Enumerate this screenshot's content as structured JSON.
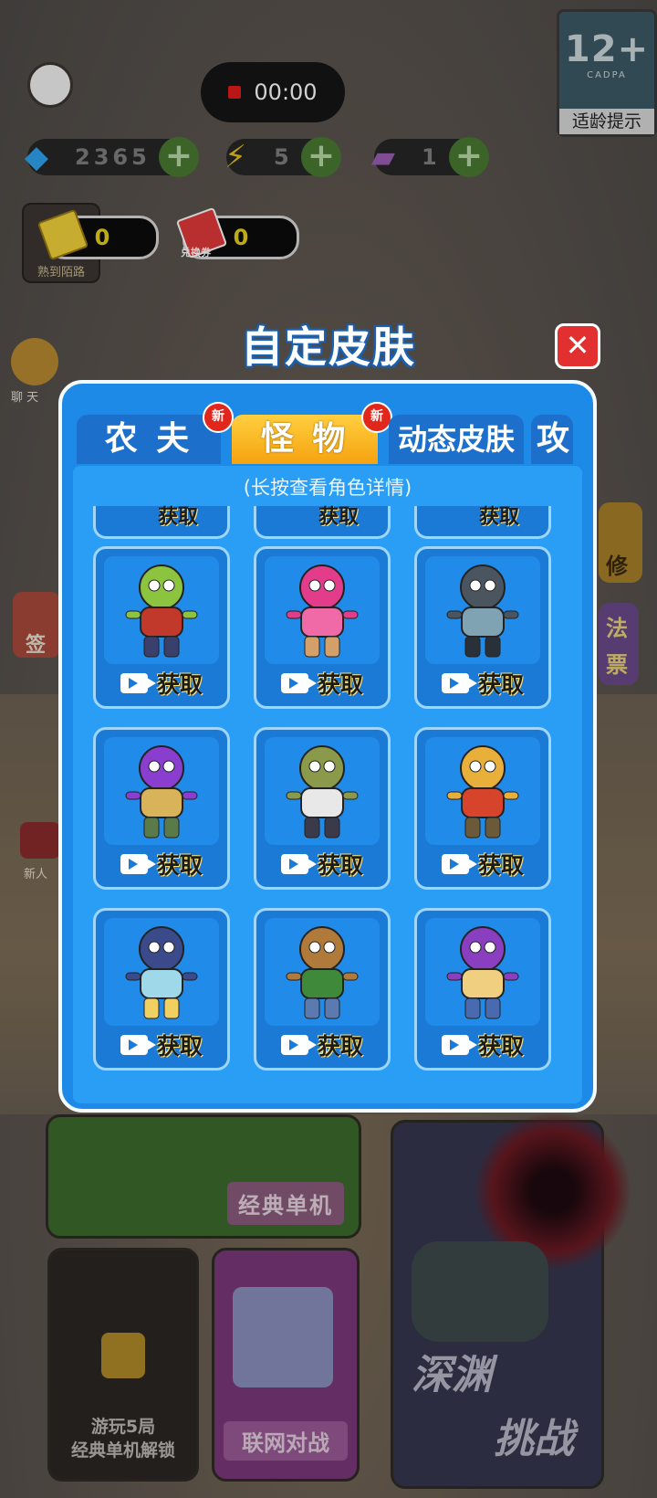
{
  "hud": {
    "timer": "00:00",
    "age_rating": {
      "number": "12+",
      "org": "CADPA",
      "tip": "适龄提示"
    },
    "resources": [
      {
        "name": "diamond",
        "icon": "diamond-icon",
        "value": "2365",
        "color": "#2fa3ee"
      },
      {
        "name": "energy",
        "icon": "lightning-icon",
        "value": "5",
        "color": "#e7c21a"
      },
      {
        "name": "ticket",
        "icon": "ticket-icon",
        "value": "1",
        "color": "#9b5fb4"
      }
    ],
    "tickets": [
      {
        "icon": "gold-ticket-icon",
        "value": "0"
      },
      {
        "icon": "red-redeem-ticket-icon",
        "value": "0",
        "label": "兑换券"
      }
    ],
    "sign_label": "熟到陌路"
  },
  "side_labels": {
    "chat": "聊 天",
    "sign": "签",
    "newbie": "新人",
    "repair": "修",
    "fa": "法",
    "piao": "票"
  },
  "dialog": {
    "title": "自定皮肤",
    "close_symbol": "✕",
    "tabs": [
      {
        "label": "农 夫",
        "badge": "新",
        "active": false
      },
      {
        "label": "怪 物",
        "badge": "新",
        "active": true
      },
      {
        "label": "动态皮肤",
        "badge": "",
        "active": false
      },
      {
        "label": "攻",
        "badge": "",
        "active": false
      }
    ],
    "hint": "(长按查看角色详情)",
    "get_label": "获取",
    "cards": [
      {
        "name": "green-zombie",
        "colors": [
          "#8cc43f",
          "#c0392b",
          "#3a3f6b"
        ]
      },
      {
        "name": "pink-swamp-monster",
        "colors": [
          "#e23c8a",
          "#f06aa8",
          "#d4a06a"
        ]
      },
      {
        "name": "armored-knight-monster",
        "colors": [
          "#4a5560",
          "#7fa3b3",
          "#2a3038"
        ]
      },
      {
        "name": "wizard-zombie",
        "colors": [
          "#8a3ed0",
          "#d8b35a",
          "#5a7a4a"
        ]
      },
      {
        "name": "muscle-zombie",
        "colors": [
          "#8a9a4a",
          "#e8e8e8",
          "#3a3a4a"
        ]
      },
      {
        "name": "cheetah-zombie",
        "colors": [
          "#e8b03a",
          "#d6452b",
          "#6a5a3a"
        ]
      },
      {
        "name": "qing-jiangshi",
        "colors": [
          "#3a4a8a",
          "#9fd8e8",
          "#f0d060"
        ]
      },
      {
        "name": "sack-head-zombie",
        "colors": [
          "#b07a3a",
          "#3f8a3a",
          "#5a7ab0"
        ]
      },
      {
        "name": "purple-crocodile",
        "colors": [
          "#8a3ec0",
          "#f0d080",
          "#4a6ab0"
        ]
      }
    ]
  },
  "modes": {
    "classic": "经典单机",
    "locked": [
      "游玩5局",
      "经典单机解锁"
    ],
    "online": "联网对战",
    "abyss": [
      "深渊",
      "挑战"
    ]
  }
}
